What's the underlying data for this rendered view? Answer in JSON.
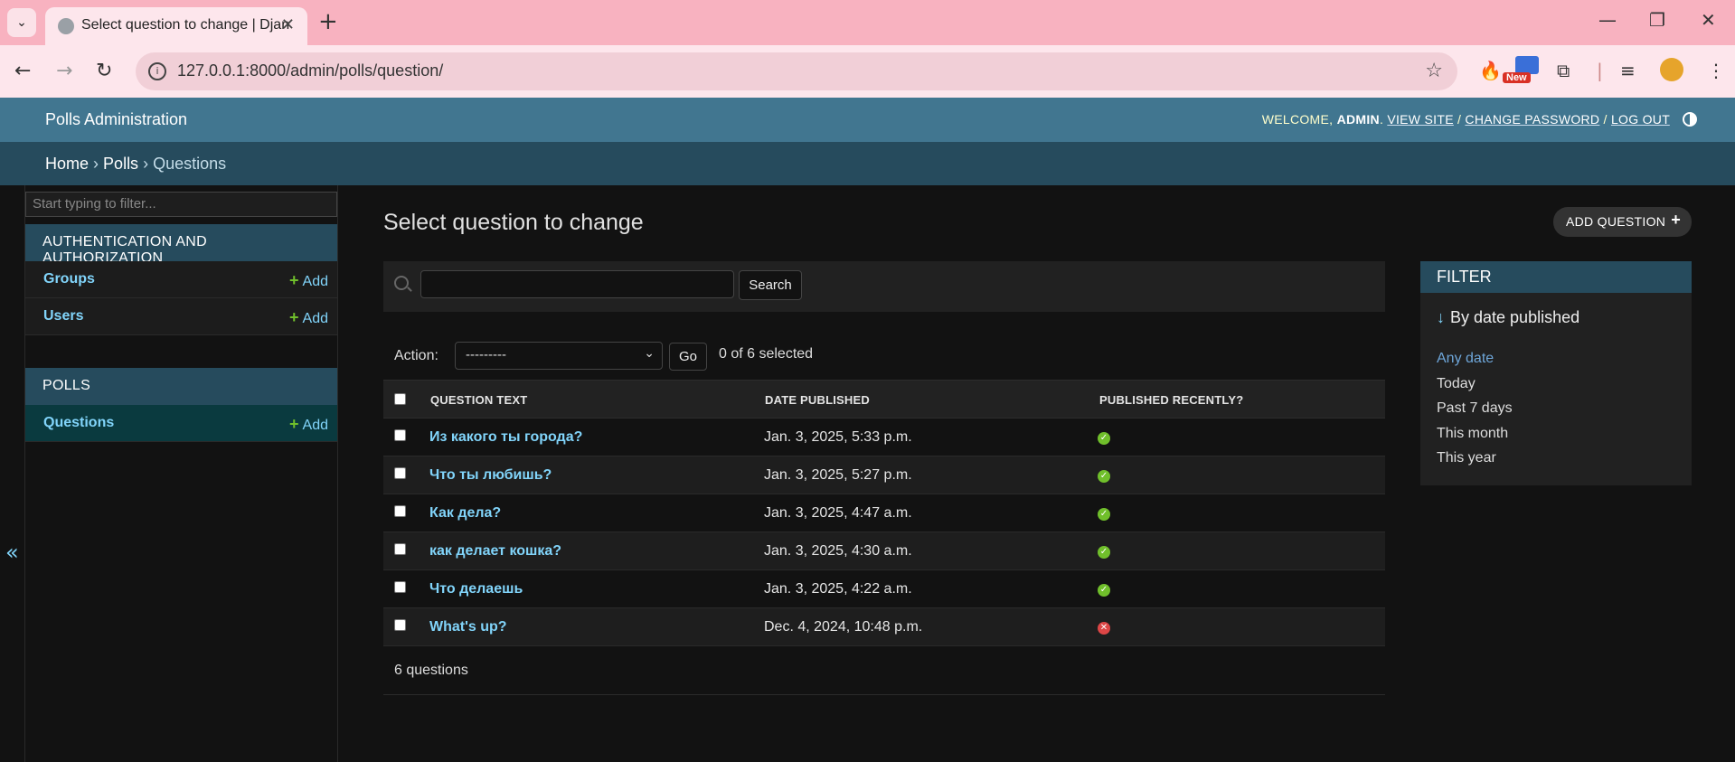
{
  "browser": {
    "tab_title": "Select question to change | Django",
    "url": "127.0.0.1:8000/admin/polls/question/",
    "new_badge": "New"
  },
  "header": {
    "branding": "Polls Administration",
    "welcome": "WELCOME,",
    "username": "ADMIN",
    "view_site": "VIEW SITE",
    "change_password": "CHANGE PASSWORD",
    "log_out": "LOG OUT"
  },
  "breadcrumbs": {
    "home": "Home",
    "app": "Polls",
    "model": "Questions",
    "sep": "›"
  },
  "sidebar": {
    "filter_placeholder": "Start typing to filter...",
    "modules": [
      {
        "caption": "AUTHENTICATION AND AUTHORIZATION",
        "models": [
          {
            "name": "Groups",
            "add": "Add"
          },
          {
            "name": "Users",
            "add": "Add"
          }
        ]
      },
      {
        "caption": "POLLS",
        "models": [
          {
            "name": "Questions",
            "add": "Add"
          }
        ]
      }
    ],
    "toggle": "«"
  },
  "content": {
    "title": "Select question to change",
    "add_button": "ADD QUESTION",
    "search_button": "Search",
    "action_label": "Action:",
    "action_selected": "---------",
    "go_button": "Go",
    "counter": "0 of 6 selected",
    "columns": [
      "QUESTION TEXT",
      "DATE PUBLISHED",
      "PUBLISHED RECENTLY?"
    ],
    "rows": [
      {
        "question": "Из какого ты города?",
        "date": "Jan. 3, 2025, 5:33 p.m.",
        "recent": true
      },
      {
        "question": "Что ты любишь?",
        "date": "Jan. 3, 2025, 5:27 p.m.",
        "recent": true
      },
      {
        "question": "Как дела?",
        "date": "Jan. 3, 2025, 4:47 a.m.",
        "recent": true
      },
      {
        "question": "как делает кошка?",
        "date": "Jan. 3, 2025, 4:30 a.m.",
        "recent": true
      },
      {
        "question": "Что делаешь",
        "date": "Jan. 3, 2025, 4:22 a.m.",
        "recent": true
      },
      {
        "question": "What's up?",
        "date": "Dec. 4, 2024, 10:48 p.m.",
        "recent": false
      }
    ],
    "paginator": "6 questions"
  },
  "filter": {
    "title": "FILTER",
    "heading": "By date published",
    "options": [
      "Any date",
      "Today",
      "Past 7 days",
      "This month",
      "This year"
    ],
    "selected": "Any date"
  },
  "colors": {
    "header": "#417690",
    "breadcrumbs": "#264b5d",
    "link": "#81d4fa",
    "yes": "#70bf2b",
    "no": "#dd4646"
  }
}
